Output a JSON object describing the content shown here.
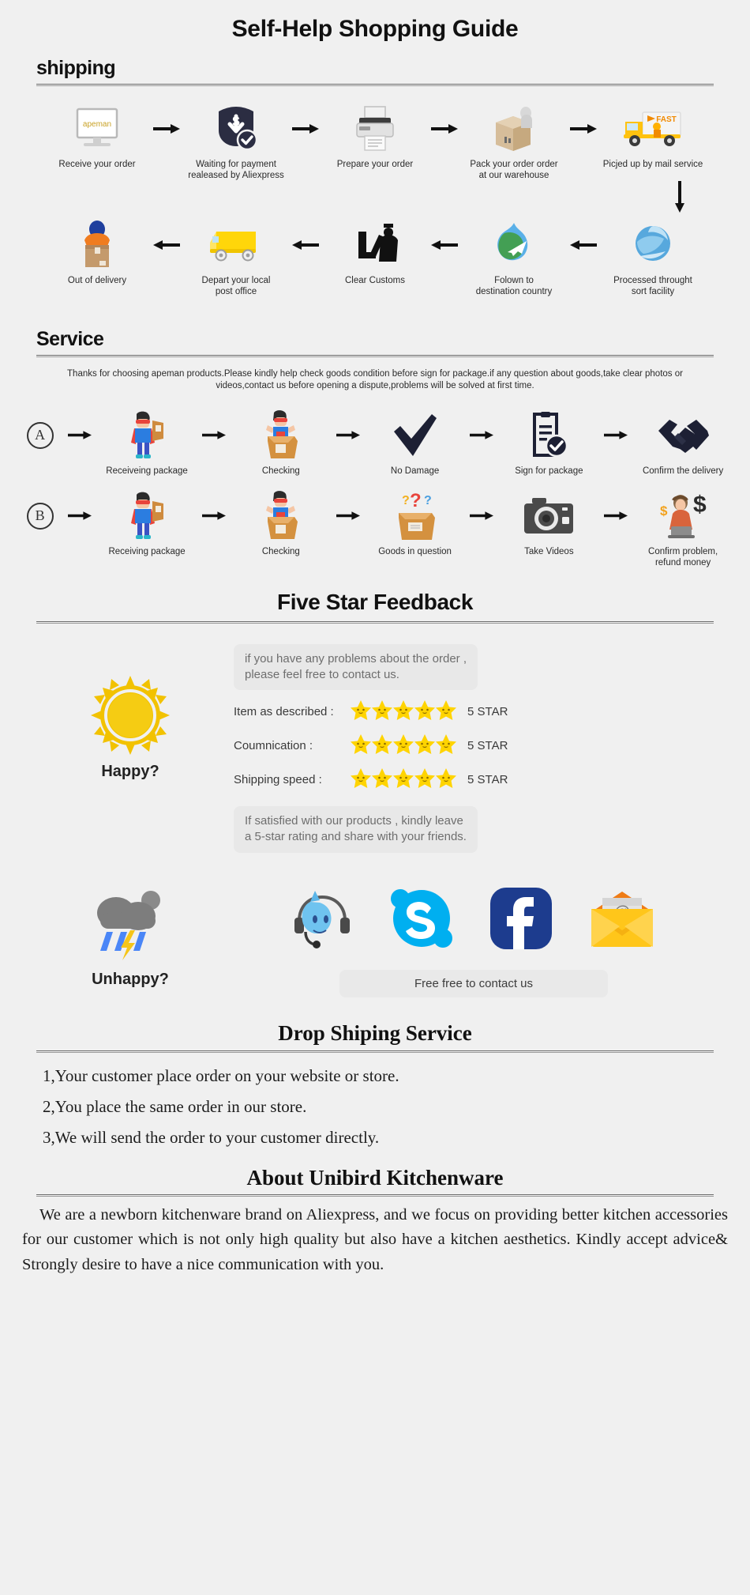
{
  "page": {
    "title": "Self-Help Shopping Guide"
  },
  "shipping": {
    "heading": "shipping",
    "row1": [
      {
        "icon": "monitor-apeman-icon",
        "caption": "Receive your order"
      },
      {
        "icon": "payment-shield-icon",
        "caption": "Waiting for payment\nrealeased by Aliexpress"
      },
      {
        "icon": "printer-icon",
        "caption": "Prepare your order"
      },
      {
        "icon": "packing-box-icon",
        "caption": "Pack your order order\nat our warehouse"
      },
      {
        "icon": "fast-truck-icon",
        "caption": "Picjed up by mail service"
      }
    ],
    "row2": [
      {
        "icon": "delivery-man-box-icon",
        "caption": "Out of delivery"
      },
      {
        "icon": "yellow-van-icon",
        "caption": "Depart your local\npost office"
      },
      {
        "icon": "customs-officer-icon",
        "caption": "Clear Customs"
      },
      {
        "icon": "globe-plane-icon",
        "caption": "Folown to\ndestination country"
      },
      {
        "icon": "sort-facility-globe-icon",
        "caption": "Processed throught\nsort facility"
      }
    ]
  },
  "service": {
    "heading": "Service",
    "note": "Thanks for choosing apeman products.Please kindly help check goods condition before sign for package.if any question about goods,take clear photos or videos,contact us before opening a dispute,problems will be solved at first time.",
    "rowA": {
      "badge": "A",
      "steps": [
        {
          "icon": "superhero-package-icon",
          "caption": "Receiveing package"
        },
        {
          "icon": "superhero-unbox-icon",
          "caption": "Checking"
        },
        {
          "icon": "checkmark-icon",
          "caption": "No Damage"
        },
        {
          "icon": "sign-document-icon",
          "caption": "Sign for package"
        },
        {
          "icon": "handshake-icon",
          "caption": "Confirm the delivery"
        }
      ]
    },
    "rowB": {
      "badge": "B",
      "steps": [
        {
          "icon": "superhero-package-icon",
          "caption": "Receiving package"
        },
        {
          "icon": "superhero-unbox-icon",
          "caption": "Checking"
        },
        {
          "icon": "question-box-icon",
          "caption": "Goods in question"
        },
        {
          "icon": "camera-icon",
          "caption": "Take Videos"
        },
        {
          "icon": "support-agent-refund-icon",
          "caption": "Confirm problem,\nrefund money"
        }
      ]
    }
  },
  "feedback": {
    "title": "Five Star Feedback",
    "bubble_top": "if you have any problems about the order ,\nplease feel free to contact us.",
    "happy_label": "Happy?",
    "ratings": [
      {
        "label": "Item as described :",
        "stars": 5,
        "value": "5 STAR"
      },
      {
        "label": "Coumnication :",
        "stars": 5,
        "value": "5 STAR"
      },
      {
        "label": "Shipping speed :",
        "stars": 5,
        "value": "5 STAR"
      }
    ],
    "bubble_bottom": "If satisfied with our products ,  kindly leave\na 5-star rating and share with your friends.",
    "unhappy_label": "Unhappy?",
    "social": [
      {
        "icon": "trademanager-headset-icon",
        "name": "TradeManager"
      },
      {
        "icon": "skype-icon",
        "name": "Skype"
      },
      {
        "icon": "facebook-icon",
        "name": "Facebook"
      },
      {
        "icon": "email-envelope-icon",
        "name": "Email"
      }
    ],
    "contact_bar": "Free free to contact us"
  },
  "dropshipping": {
    "title": "Drop Shiping Service",
    "items": [
      "1,Your customer place order on your website or store.",
      "2,You place the same order in our store.",
      "3,We will send the order to your customer directly."
    ]
  },
  "about": {
    "title": "About Unibird Kitchenware",
    "paragraph": "We are a newborn kitchenware brand on Aliexpress, and we focus on providing better kitchen accessories for our customer which is not only high quality but also have a kitchen aesthetics. Kindly accept advice& Strongly desire to have a nice communication with you."
  },
  "colors": {
    "background": "#f0f0f0",
    "accent_yellow": "#f5c518",
    "star_yellow": "#FFD400",
    "skype_blue": "#00AFF0",
    "facebook_blue": "#1d3c8e",
    "dark": "#252836"
  }
}
